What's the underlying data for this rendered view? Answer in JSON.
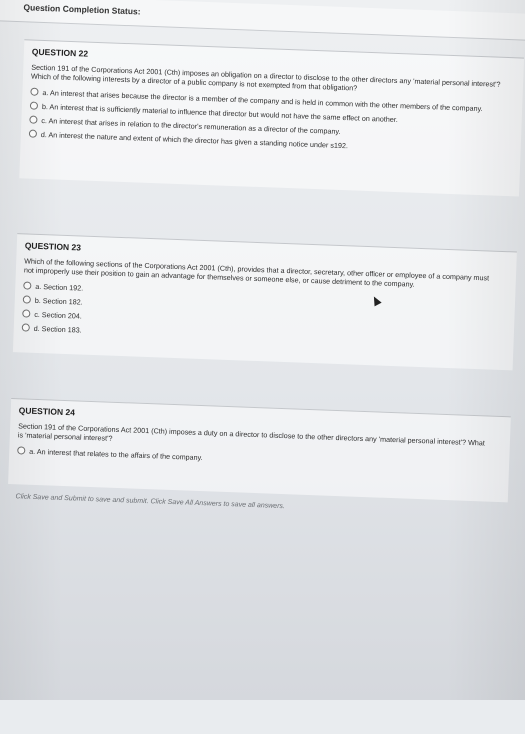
{
  "status_bar": {
    "label": "Question Completion Status:"
  },
  "questions": [
    {
      "title": "QUESTION 22",
      "prompt": "Section 191 of the Corporations Act 2001 (Cth) imposes an obligation on a director to disclose to the other directors any 'material personal interest'? Which of the following interests by a director of a public company is not exempted from that obligation?",
      "options": [
        "a. An interest that arises because the director is a member of the company and is held in common with the other members of the company.",
        "b. An interest that is sufficiently material to influence that director but would not have the same effect on another.",
        "c. An interest that arises in relation to the director's remuneration as a director of the company.",
        "d. An interest the nature and extent of which the director has given a standing notice under s192."
      ]
    },
    {
      "title": "QUESTION 23",
      "prompt": "Which of the following sections of the Corporations Act 2001 (Cth), provides that a director, secretary, other officer or employee of a company must not improperly use their position to gain an advantage for themselves or someone else, or cause detriment to the company.",
      "options": [
        "a. Section 192.",
        "b. Section 182.",
        "c. Section 204.",
        "d. Section 183."
      ]
    },
    {
      "title": "QUESTION 24",
      "prompt": "Section 191 of the Corporations Act 2001 (Cth) imposes a duty on a director to disclose to the other directors any 'material personal interest'? What is 'material personal interest'?",
      "options": [
        "a. An interest that relates to the affairs of the company."
      ]
    }
  ],
  "footer": {
    "note": "Click Save and Submit to save and submit. Click Save All Answers to save all answers."
  }
}
